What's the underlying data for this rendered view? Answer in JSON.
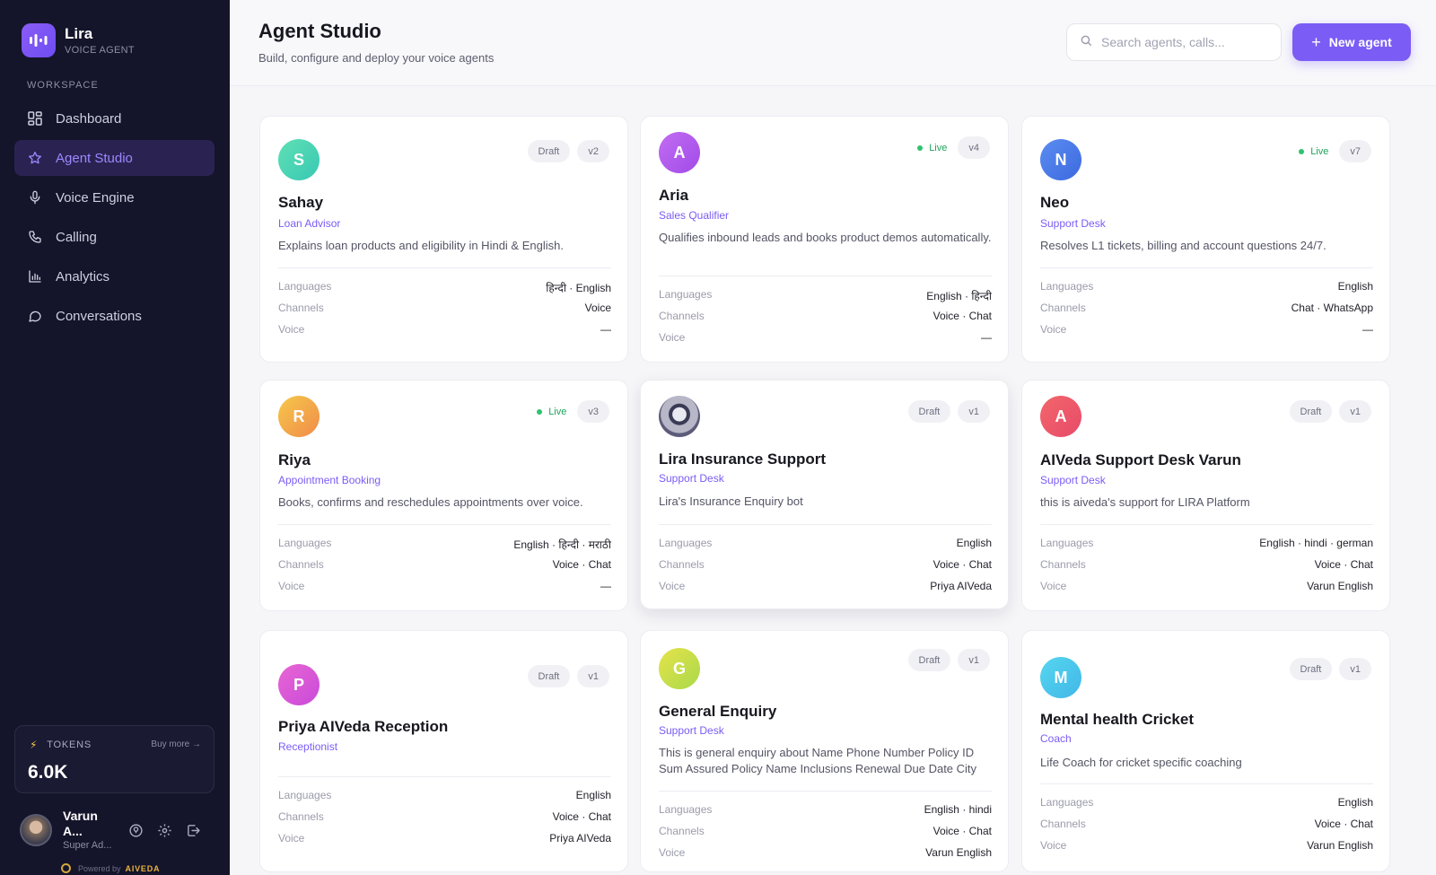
{
  "brand": {
    "name": "Lira",
    "subtitle": "VOICE AGENT"
  },
  "sidebar": {
    "section_label": "WORKSPACE",
    "items": [
      {
        "label": "Dashboard",
        "icon": "grid-icon",
        "active": false
      },
      {
        "label": "Agent Studio",
        "icon": "star-icon",
        "active": true
      },
      {
        "label": "Voice Engine",
        "icon": "mic-icon",
        "active": false
      },
      {
        "label": "Calling",
        "icon": "phone-icon",
        "active": false
      },
      {
        "label": "Analytics",
        "icon": "bar-chart-icon",
        "active": false
      },
      {
        "label": "Conversations",
        "icon": "chat-bubble-icon",
        "active": false
      }
    ],
    "tokens": {
      "label": "TOKENS",
      "buy_more": "Buy more →",
      "value": "6.0K"
    },
    "user": {
      "name": "Varun A...",
      "role": "Super Ad..."
    },
    "powered_by": {
      "label": "Powered by",
      "brand": "AIVEDA"
    }
  },
  "header": {
    "title": "Agent Studio",
    "subtitle": "Build, configure and deploy your voice agents",
    "search_placeholder": "Search agents, calls...",
    "new_button": "New agent"
  },
  "meta_labels": {
    "languages": "Languages",
    "channels": "Channels",
    "voice": "Voice"
  },
  "agents": [
    {
      "initial": "S",
      "name": "Sahay",
      "role": "Loan Advisor",
      "description": "Explains loan products and eligibility in Hindi & English.",
      "status": "Draft",
      "version": "v2",
      "languages": "हिन्दी · English",
      "channels": "Voice",
      "voice": "—",
      "color_from": "#5fe0b5",
      "color_to": "#38c8b3"
    },
    {
      "initial": "A",
      "name": "Aria",
      "role": "Sales Qualifier",
      "description": "Qualifies inbound leads and books product demos automatically.",
      "status": "Live",
      "version": "v4",
      "languages": "English · हिन्दी",
      "channels": "Voice · Chat",
      "voice": "—",
      "color_from": "#c26cf3",
      "color_to": "#a24be8"
    },
    {
      "initial": "N",
      "name": "Neo",
      "role": "Support Desk",
      "description": "Resolves L1 tickets, billing and account questions 24/7.",
      "status": "Live",
      "version": "v7",
      "languages": "English",
      "channels": "Chat · WhatsApp",
      "voice": "—",
      "color_from": "#5b8cf0",
      "color_to": "#3c6ae0"
    },
    {
      "initial": "R",
      "name": "Riya",
      "role": "Appointment Booking",
      "description": "Books, confirms and reschedules appointments over voice.",
      "status": "Live",
      "version": "v3",
      "languages": "English · हिन्दी · मराठी",
      "channels": "Voice · Chat",
      "voice": "—",
      "color_from": "#f6c84a",
      "color_to": "#f08b4a"
    },
    {
      "initial": "",
      "name": "Lira Insurance Support",
      "role": "Support Desk",
      "description": "Lira's Insurance Enquiry bot",
      "status": "Draft",
      "version": "v1",
      "languages": "English",
      "channels": "Voice · Chat",
      "voice": "Priya AIVeda",
      "color_from": "#d7d7e4",
      "color_to": "#5c5c7a"
    },
    {
      "initial": "A",
      "name": "AIVeda Support Desk Varun",
      "role": "Support Desk",
      "description": "this is aiveda's support for LIRA Platform",
      "status": "Draft",
      "version": "v1",
      "languages": "English · hindi · german",
      "channels": "Voice · Chat",
      "voice": "Varun English",
      "color_from": "#f2676a",
      "color_to": "#e84a6a"
    },
    {
      "initial": "P",
      "name": "Priya AIVeda Reception",
      "role": "Receptionist",
      "description": "",
      "status": "Draft",
      "version": "v1",
      "languages": "English",
      "channels": "Voice · Chat",
      "voice": "Priya AIVeda",
      "color_from": "#e965d4",
      "color_to": "#c84bd9"
    },
    {
      "initial": "G",
      "name": "General Enquiry",
      "role": "Support Desk",
      "description": "This is general enquiry about Name Phone Number Policy ID Sum Assured Policy Name Inclusions Renewal Due Date City",
      "status": "Draft",
      "version": "v1",
      "languages": "English · hindi",
      "channels": "Voice · Chat",
      "voice": "Varun English",
      "color_from": "#e6e34a",
      "color_to": "#a9d94a"
    },
    {
      "initial": "M",
      "name": "Mental health Cricket",
      "role": "Coach",
      "description": "Life Coach for cricket specific coaching",
      "status": "Draft",
      "version": "v1",
      "languages": "English",
      "channels": "Voice · Chat",
      "voice": "Varun English",
      "color_from": "#56d6ef",
      "color_to": "#41b7e8"
    }
  ]
}
